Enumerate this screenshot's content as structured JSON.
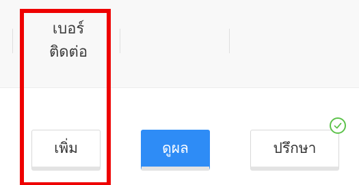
{
  "table": {
    "header": {
      "contact_number_label": "เบอร์\nติดต่อ"
    }
  },
  "actions": {
    "add_label": "เพิ่ม",
    "view_result_label": "ดูผล",
    "consult_label": "ปรึกษา"
  },
  "icons": {
    "consult_status": "check-circle-icon"
  },
  "colors": {
    "primary_button": "#2e8cf6",
    "success": "#5cc24a",
    "highlight": "#ee0000",
    "header_background": "#f8f8f8"
  }
}
